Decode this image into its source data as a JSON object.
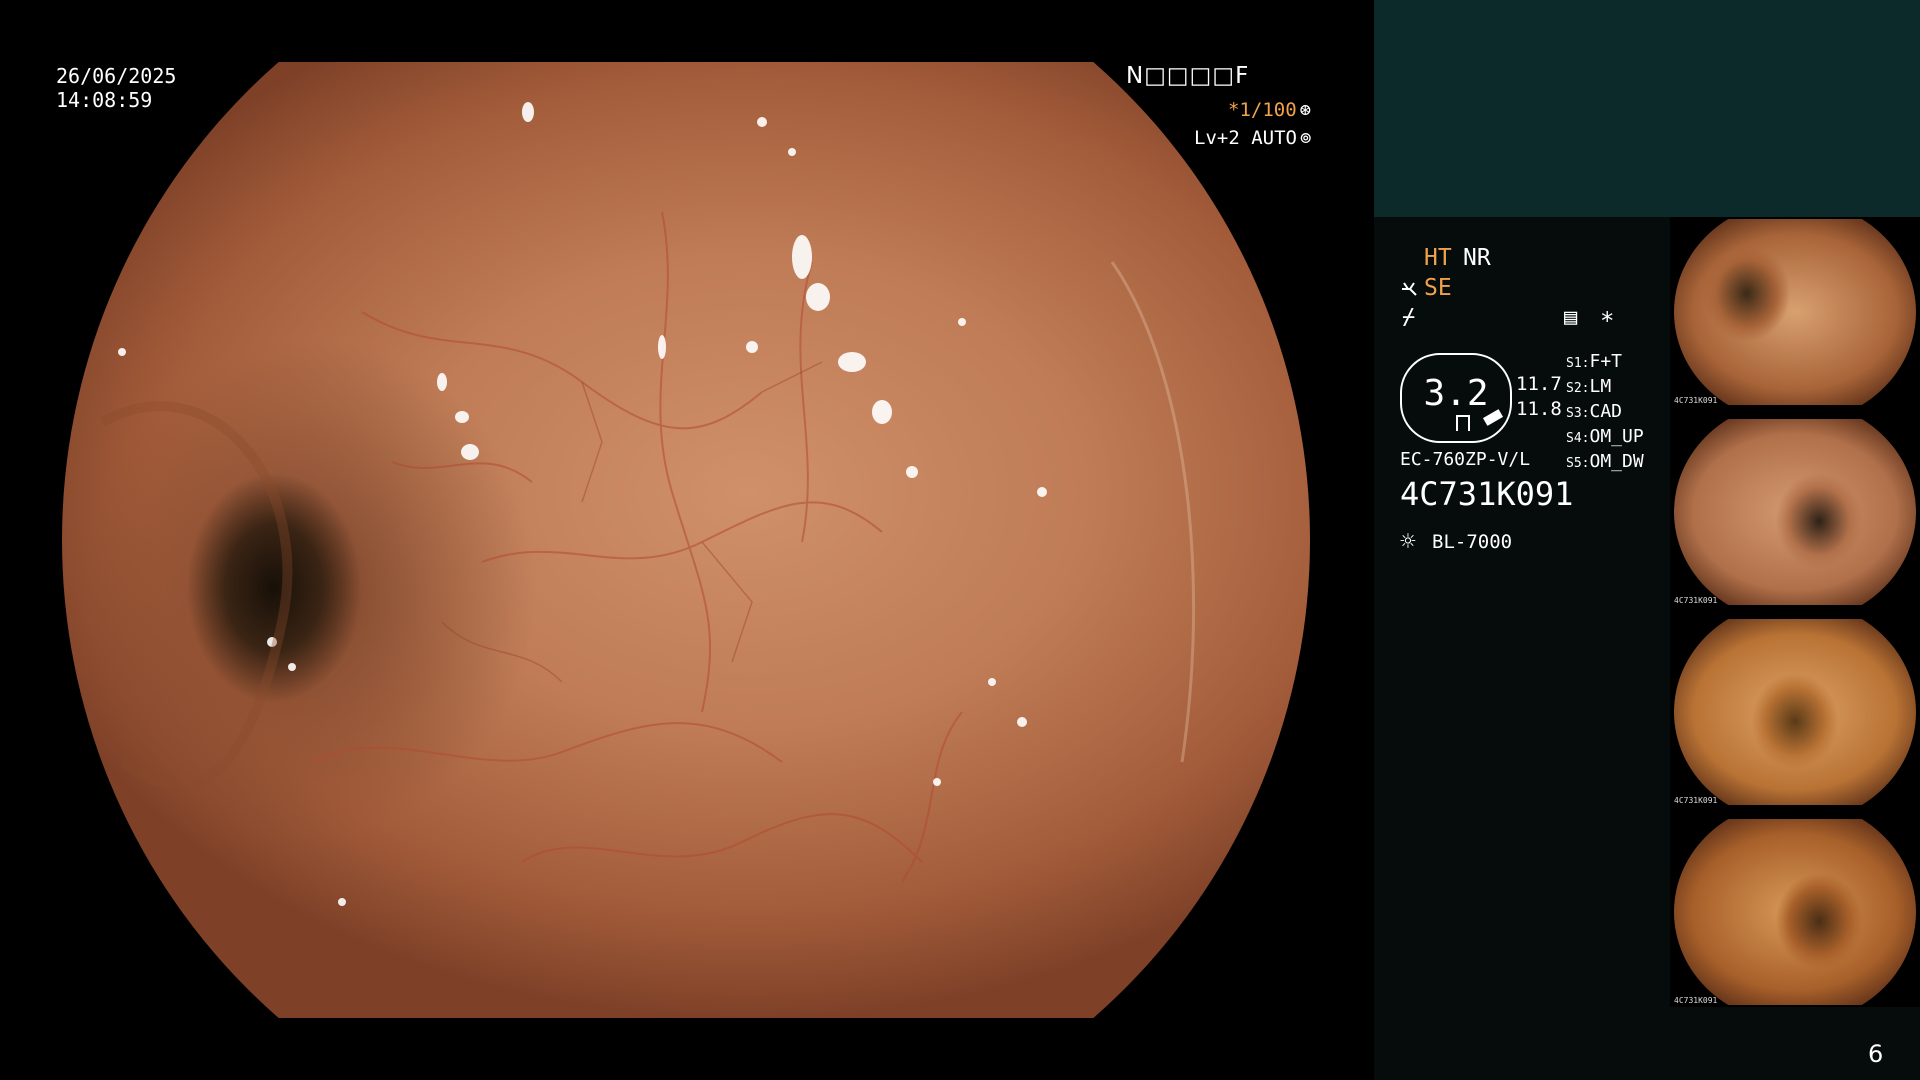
{
  "overlay": {
    "date": "26/06/2025",
    "time": "14:08:59",
    "mode_code": "N□□□□F",
    "shutter": "*1/100",
    "shutter_icon": "⊛",
    "level": "Lv+2 AUTO",
    "level_icon": "⊚"
  },
  "panel": {
    "ht": "HT",
    "nr": "NR",
    "se": "SE",
    "se_icon": "scope-bend-icon",
    "f_icon_glyph": "⌿",
    "menu_icon": "▤",
    "star": "*",
    "meter_value": "3.2",
    "meter_readout_1": "11.7",
    "meter_readout_2": "11.8",
    "presets": [
      {
        "key": "S1:",
        "value": "F+T"
      },
      {
        "key": "S2:",
        "value": "LM"
      },
      {
        "key": "S3:",
        "value": "CAD"
      },
      {
        "key": "S4:",
        "value": "OM_UP"
      },
      {
        "key": "S5:",
        "value": "OM_DW"
      }
    ],
    "scope_model": "EC-760ZP-V/L",
    "scope_serial": "4C731K091",
    "light_source_icon": "☼",
    "light_source": "BL-7000"
  },
  "thumbnails": [
    {
      "caption": "4C731K091",
      "palette": [
        "#d8a070",
        "#a86438",
        "#3a2a18"
      ]
    },
    {
      "caption": "4C731K091",
      "palette": [
        "#d49a72",
        "#b0704a",
        "#2e2218"
      ]
    },
    {
      "caption": "4C731K091",
      "palette": [
        "#e0a468",
        "#b87234",
        "#5a3a18"
      ]
    },
    {
      "caption": "4C731K091",
      "palette": [
        "#d89a58",
        "#a8602a",
        "#4a2e16"
      ]
    }
  ],
  "page_number": "6",
  "colors": {
    "accent_orange": "#f2a24a",
    "panel_top_bg": "#0c2a2a",
    "panel_bg": "#060c0c"
  }
}
